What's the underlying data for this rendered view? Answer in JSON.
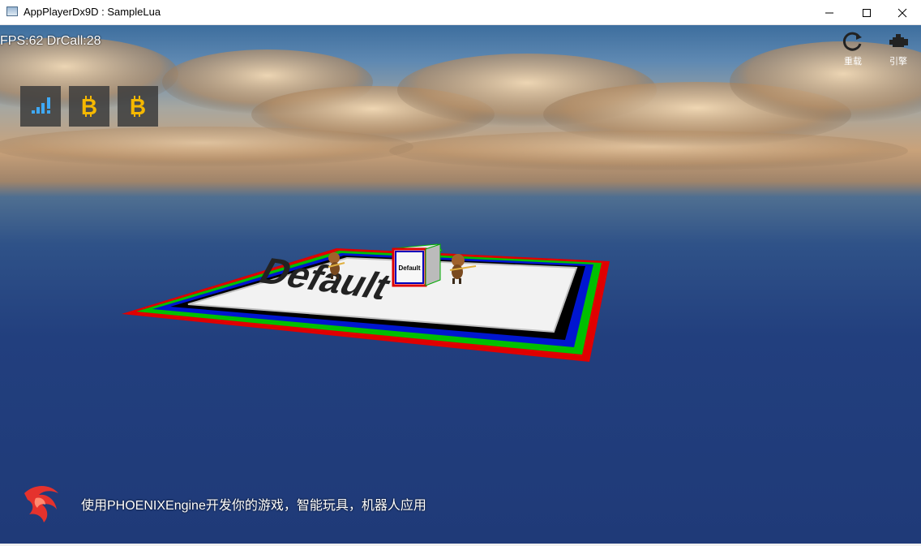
{
  "window": {
    "title": "AppPlayerDx9D : SampleLua",
    "controls": [
      "minimize",
      "maximize",
      "close"
    ]
  },
  "hud": {
    "fps_text": "FPS:62 DrCall:28",
    "left_buttons": [
      {
        "icon": "signal-icon"
      },
      {
        "icon": "bitcoin-icon"
      },
      {
        "icon": "bitcoin-icon"
      }
    ],
    "reload_label": "重载",
    "engine_label": "引擎"
  },
  "scene": {
    "platform_label": "Default",
    "cube_label": "Default"
  },
  "footer": {
    "text": "使用PHOENIXEngine开发你的游戏，智能玩具，机器人应用"
  },
  "colors": {
    "accent_blue": "#3fa9f5",
    "coin_yellow": "#f5b800",
    "button_bg": "#3c3c3c",
    "logo_red": "#e5322d"
  }
}
